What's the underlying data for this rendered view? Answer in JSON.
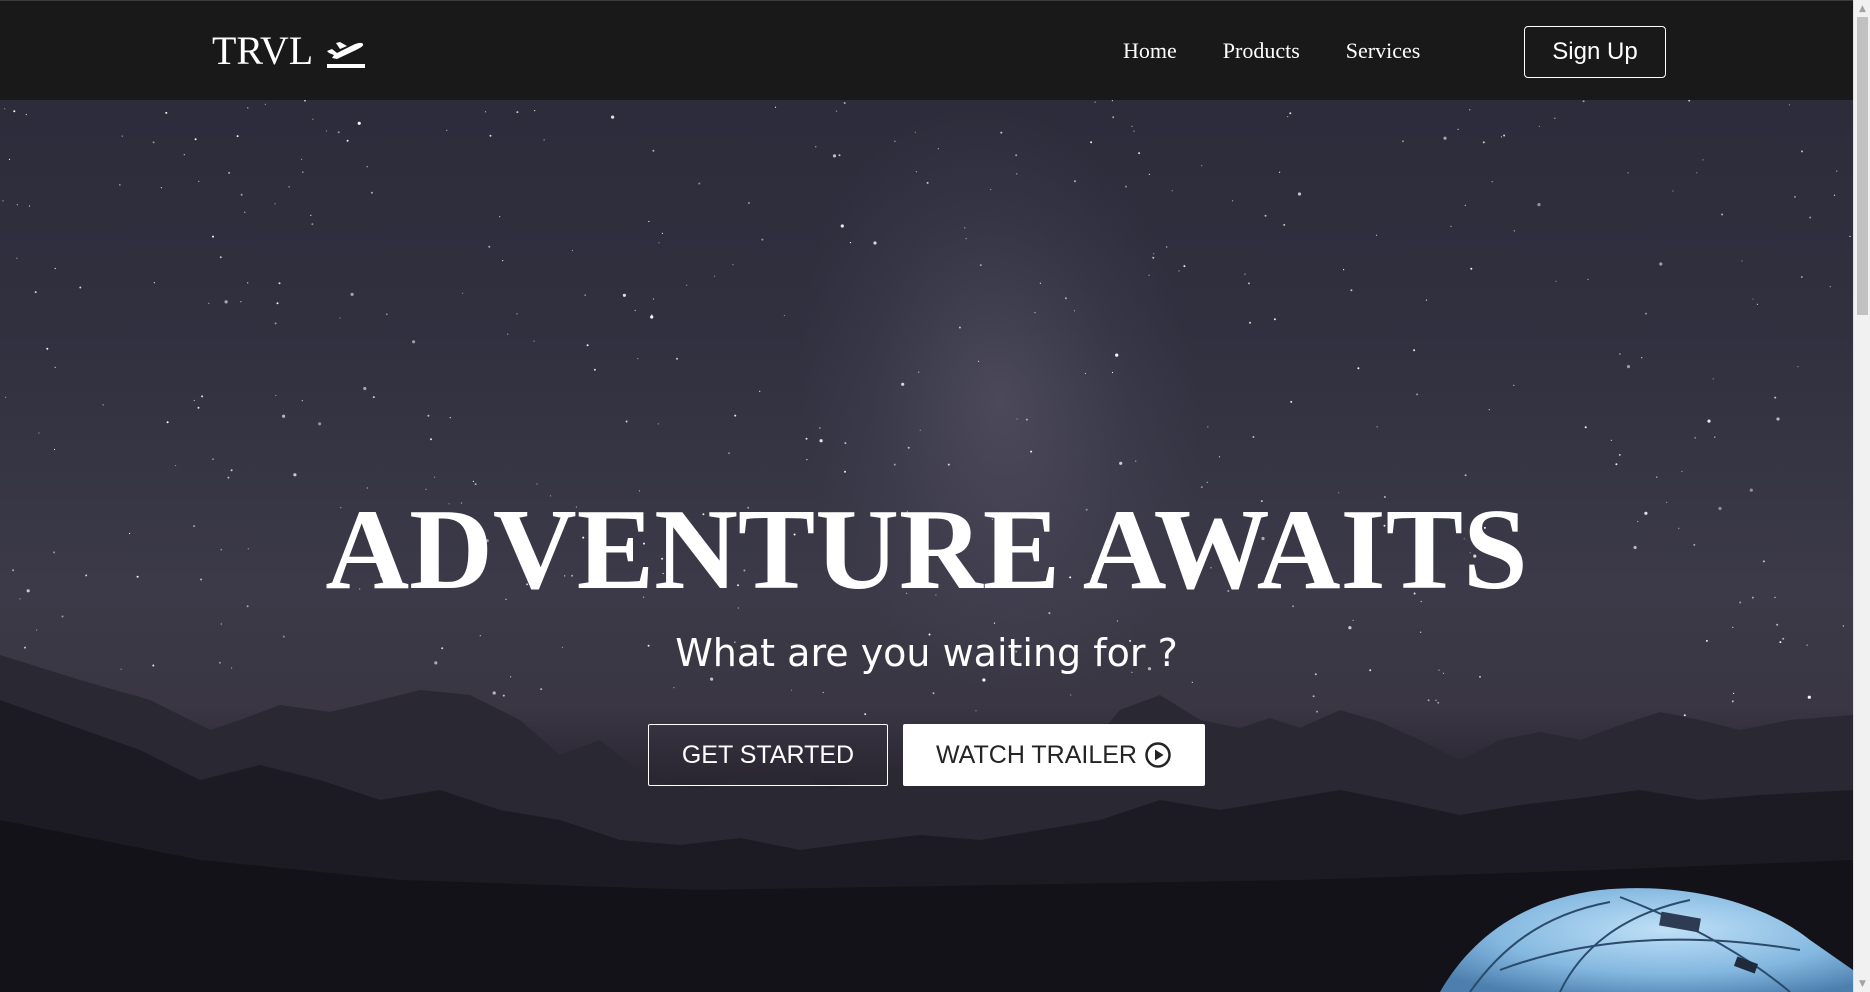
{
  "navbar": {
    "logo_text": "TRVL",
    "logo_icon": "plane-departure-icon",
    "links": [
      {
        "label": "Home"
      },
      {
        "label": "Products"
      },
      {
        "label": "Services"
      }
    ],
    "signup_label": "Sign Up"
  },
  "hero": {
    "title": "ADVENTURE AWAITS",
    "subtitle": "What are you waiting for ?",
    "get_started_label": "GET STARTED",
    "watch_trailer_label": "WATCH TRAILER",
    "watch_trailer_icon": "play-circle-icon",
    "background": "night-sky-mountains-tent"
  },
  "scrollbar": {
    "up_arrow": "▲",
    "down_arrow": "▼"
  },
  "colors": {
    "navbar_bg": "#1a1919",
    "hero_text": "#ffffff",
    "button_solid_bg": "#ffffff",
    "button_solid_text": "#242424"
  }
}
